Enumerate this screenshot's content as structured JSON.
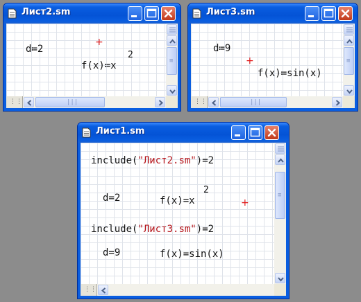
{
  "windows": {
    "w2": {
      "title": "Лист2.sm",
      "expr1": "d≔2",
      "f_left": "f(x)≔x",
      "f_exp": "2"
    },
    "w3": {
      "title": "Лист3.sm",
      "expr1": "d≔9",
      "f_left": "f(x)≔sin(x)"
    },
    "w1": {
      "title": "Лист1.sm",
      "inc1_fn": "include",
      "inc1_open": "(",
      "inc1_str": "\"Лист2.sm\"",
      "inc1_close": ")",
      "inc1_result": "=2",
      "d1": "d=2",
      "f1": "f(x)=x",
      "f1_exp": "2",
      "inc2_fn": "include",
      "inc2_open": "(",
      "inc2_str": "\"Лист3.sm\"",
      "inc2_close": ")",
      "inc2_result": "=2",
      "d2": "d=9",
      "f2": "f(x)=sin(x)"
    }
  },
  "icons": {
    "title": "document-icon",
    "minimize": "minimize-icon",
    "maximize": "maximize-icon",
    "close": "close-icon",
    "cursor": "red-cross-cursor"
  },
  "colors": {
    "titlebar": "#0a5ee0",
    "close_button": "#c1391a",
    "string_literal": "#b5141a",
    "cursor": "#e01818"
  }
}
